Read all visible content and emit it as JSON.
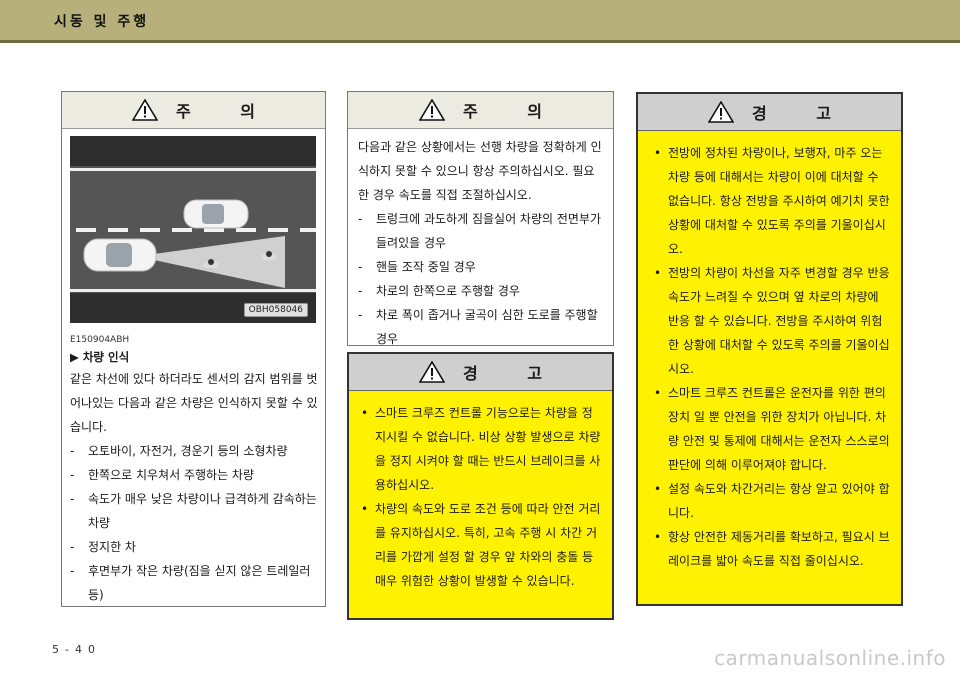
{
  "header": {
    "title": "시동 및 주행"
  },
  "left_box": {
    "heading": "주  의",
    "figure_label": "OBH058046",
    "code": "E150904ABH",
    "subheading": "▶ 차량 인식",
    "intro": "같은 차선에 있다 하더라도 센서의 감지 범위를 벗어나있는 다음과 같은 차량은 인식하지 못할 수 있습니다.",
    "items": [
      "오토바이, 자전거, 경운기 등의 소형차량",
      "한쪽으로 치우쳐서 주행하는 차량",
      "속도가 매우 낮은 차량이나 급격하게 감속하는 차량",
      "정지한 차",
      "후면부가 작은 차량(짐을 싣지 않은 트레일러 등)"
    ]
  },
  "middle_top_box": {
    "heading": "주  의",
    "intro": "다음과 같은 상황에서는 선행 차량을 정확하게 인식하지 못할 수 있으니 항상 주의하십시오. 필요한 경우 속도를 직접 조절하십시오.",
    "items": [
      "트렁크에 과도하게 짐을실어 차량의 전면부가 들려있을 경우",
      "핸들 조작 중일 경우",
      "차로의 한쪽으로 주행할 경우",
      "차로 폭이 좁거나 굴곡이 심한 도로를 주행할 경우"
    ]
  },
  "middle_bottom_box": {
    "heading": "경  고",
    "items": [
      "스마트 크루즈 컨트롤 기능으로는 차량을 정지시킬 수 없습니다. 비상 상황 발생으로 차량을 정지 시켜야 할 때는 반드시 브레이크를 사용하십시오.",
      "차량의 속도와 도로 조건 등에 따라 안전 거리를 유지하십시오. 특히, 고속 주행 시 차간 거리를 가깝게 설정 할 경우 앞 차와의 충돌 등 매우 위험한 상황이 발생할 수 있습니다."
    ]
  },
  "right_box": {
    "heading": "경  고",
    "items": [
      "전방에 정차된 차량이나, 보행자, 마주 오는 차량 등에 대해서는 차량이 이에 대처할 수 없습니다. 항상 전방을 주시하여 예기치 못한 상황에 대처할 수 있도록 주의를 기울이십시오.",
      "전방의 차량이 차선을 자주 변경할 경우 반응 속도가 느려질 수 있으며 옆 차로의 차량에 반응 할 수 있습니다. 전방을 주시하여 위험한 상황에 대처할 수 있도록 주의를 기울이십시오.",
      "스마트 크루즈 컨트롤은 운전자를 위한 편의 장치 일 뿐 안전을 위한 장치가 아닙니다. 차량 안전 및 통제에 대해서는 운전자 스스로의 판단에 의해 이루어져야 합니다.",
      "설정 속도와 차간거리는 항상 알고 있어야 합니다.",
      "항상 안전한 제동거리를 확보하고, 필요시 브레이크를 밟아 속도를 직접 줄이십시오."
    ]
  },
  "footer": {
    "page_number": "5-40",
    "watermark": "carmanualsonline.info"
  },
  "colors": {
    "header": "#b7b07a",
    "warning_fill": "#fff200",
    "caution_head": "#ecebe1"
  },
  "icons": [
    "warning-triangle-icon"
  ]
}
